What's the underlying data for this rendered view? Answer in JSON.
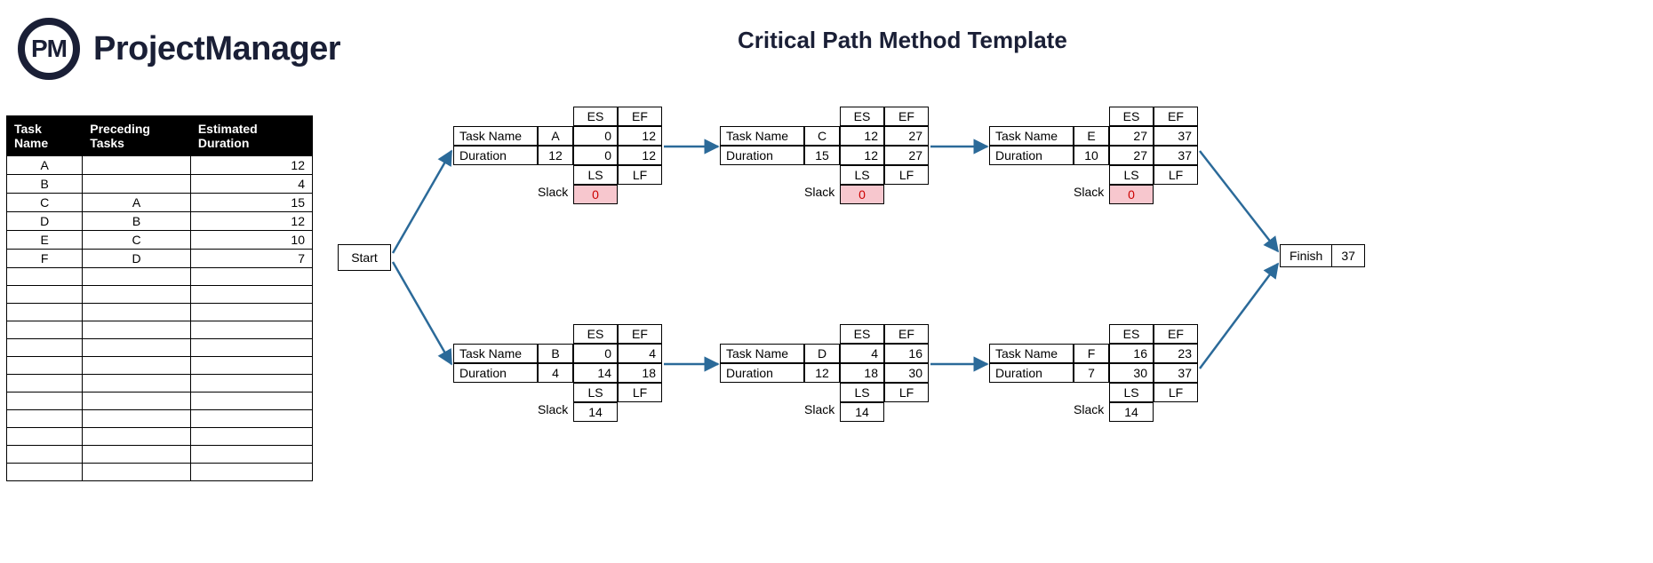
{
  "brand": {
    "initials": "PM",
    "name": "ProjectManager"
  },
  "title": "Critical Path Method Template",
  "table": {
    "headers": [
      "Task Name",
      "Preceding Tasks",
      "Estimated Duration"
    ],
    "rows": [
      {
        "task": "A",
        "pred": "",
        "dur": "12"
      },
      {
        "task": "B",
        "pred": "",
        "dur": "4"
      },
      {
        "task": "C",
        "pred": "A",
        "dur": "15"
      },
      {
        "task": "D",
        "pred": "B",
        "dur": "12"
      },
      {
        "task": "E",
        "pred": "C",
        "dur": "10"
      },
      {
        "task": "F",
        "pred": "D",
        "dur": "7"
      }
    ],
    "blank_rows": 12
  },
  "labels": {
    "start": "Start",
    "finish": "Finish",
    "task_name": "Task Name",
    "duration": "Duration",
    "es": "ES",
    "ef": "EF",
    "ls": "LS",
    "lf": "LF",
    "slack": "Slack"
  },
  "finish_value": "37",
  "nodes": {
    "A": {
      "task": "A",
      "dur": "12",
      "es": "0",
      "ef": "12",
      "ls": "0",
      "lf": "12",
      "slack": "0",
      "critical": true
    },
    "B": {
      "task": "B",
      "dur": "4",
      "es": "0",
      "ef": "4",
      "ls": "14",
      "lf": "18",
      "slack": "14",
      "critical": false
    },
    "C": {
      "task": "C",
      "dur": "15",
      "es": "12",
      "ef": "27",
      "ls": "12",
      "lf": "27",
      "slack": "0",
      "critical": true
    },
    "D": {
      "task": "D",
      "dur": "12",
      "es": "4",
      "ef": "16",
      "ls": "18",
      "lf": "30",
      "slack": "14",
      "critical": false
    },
    "E": {
      "task": "E",
      "dur": "10",
      "es": "27",
      "ef": "37",
      "ls": "27",
      "lf": "37",
      "slack": "0",
      "critical": true
    },
    "F": {
      "task": "F",
      "dur": "7",
      "es": "16",
      "ef": "23",
      "ls": "30",
      "lf": "37",
      "slack": "14",
      "critical": false
    }
  }
}
